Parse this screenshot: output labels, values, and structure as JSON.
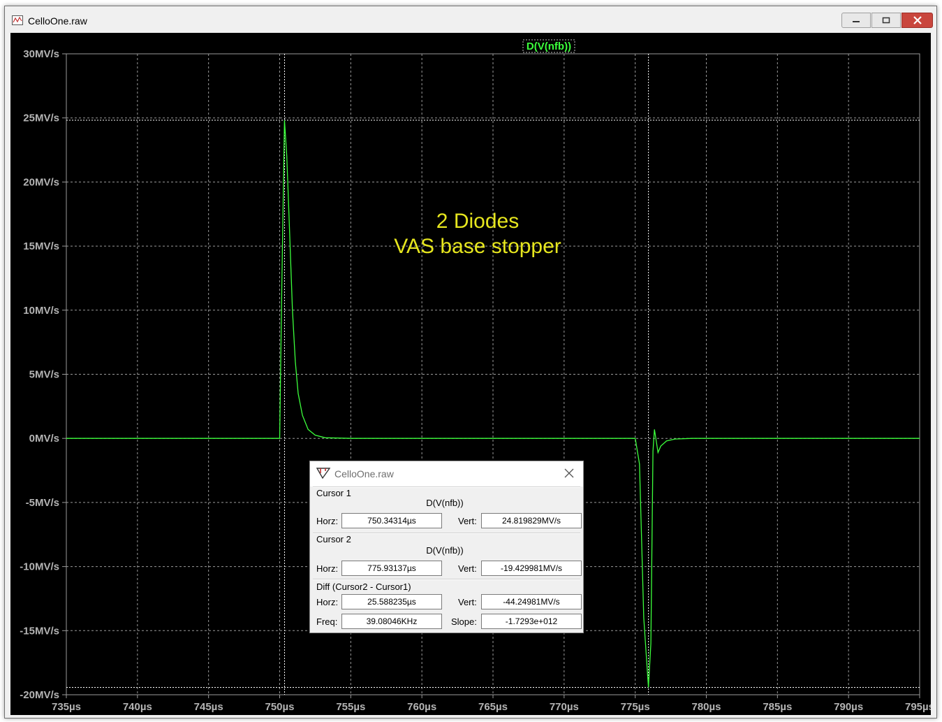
{
  "window": {
    "title": "CelloOne.raw"
  },
  "plot": {
    "trace_label": "D(V(nfb))",
    "trace_color": "#3cff3c",
    "annotation_line1": "2 Diodes",
    "annotation_line2": "VAS base stopper",
    "annotation_color": "#e6e61e",
    "background": "#000000"
  },
  "chart_data": {
    "type": "line",
    "xlabel": "",
    "ylabel": "",
    "xlim": [
      735,
      795
    ],
    "ylim": [
      -20,
      30
    ],
    "x_ticks": [
      "735µs",
      "740µs",
      "745µs",
      "750µs",
      "755µs",
      "760µs",
      "765µs",
      "770µs",
      "775µs",
      "780µs",
      "785µs",
      "790µs",
      "795µs"
    ],
    "y_ticks": [
      "30MV/s",
      "25MV/s",
      "20MV/s",
      "15MV/s",
      "10MV/s",
      "5MV/s",
      "0MV/s",
      "-5MV/s",
      "-10MV/s",
      "-15MV/s",
      "-20MV/s"
    ],
    "grid": true,
    "series": [
      {
        "name": "D(V(nfb))",
        "x": [
          735,
          750.0,
          750.15,
          750.34,
          750.5,
          750.7,
          750.9,
          751.1,
          751.3,
          751.6,
          752.0,
          752.5,
          753.2,
          755,
          775.0,
          775.3,
          775.6,
          775.93,
          776.1,
          776.25,
          776.35,
          776.45,
          776.6,
          776.8,
          777.2,
          777.8,
          779,
          795
        ],
        "y": [
          0,
          0,
          12,
          24.82,
          22,
          16,
          10,
          6,
          3.5,
          1.8,
          0.7,
          0.25,
          0.05,
          0,
          0,
          -2,
          -14,
          -19.43,
          -16,
          -1,
          0.7,
          0,
          -1.1,
          -0.6,
          -0.2,
          -0.05,
          0,
          0
        ]
      }
    ],
    "cursors": [
      {
        "x": 750.34314,
        "y": 24.819829
      },
      {
        "x": 775.93137,
        "y": -19.429981
      }
    ]
  },
  "dialog": {
    "title": "CelloOne.raw",
    "cursor1": {
      "heading": "Cursor 1",
      "trace": "D(V(nfb))",
      "horz_label": "Horz:",
      "horz": "750.34314µs",
      "vert_label": "Vert:",
      "vert": "24.819829MV/s"
    },
    "cursor2": {
      "heading": "Cursor 2",
      "trace": "D(V(nfb))",
      "horz_label": "Horz:",
      "horz": "775.93137µs",
      "vert_label": "Vert:",
      "vert": "-19.429981MV/s"
    },
    "diff": {
      "heading": "Diff (Cursor2 - Cursor1)",
      "horz_label": "Horz:",
      "horz": "25.588235µs",
      "vert_label": "Vert:",
      "vert": "-44.24981MV/s",
      "freq_label": "Freq:",
      "freq": "39.08046KHz",
      "slope_label": "Slope:",
      "slope": "-1.7293e+012"
    }
  }
}
